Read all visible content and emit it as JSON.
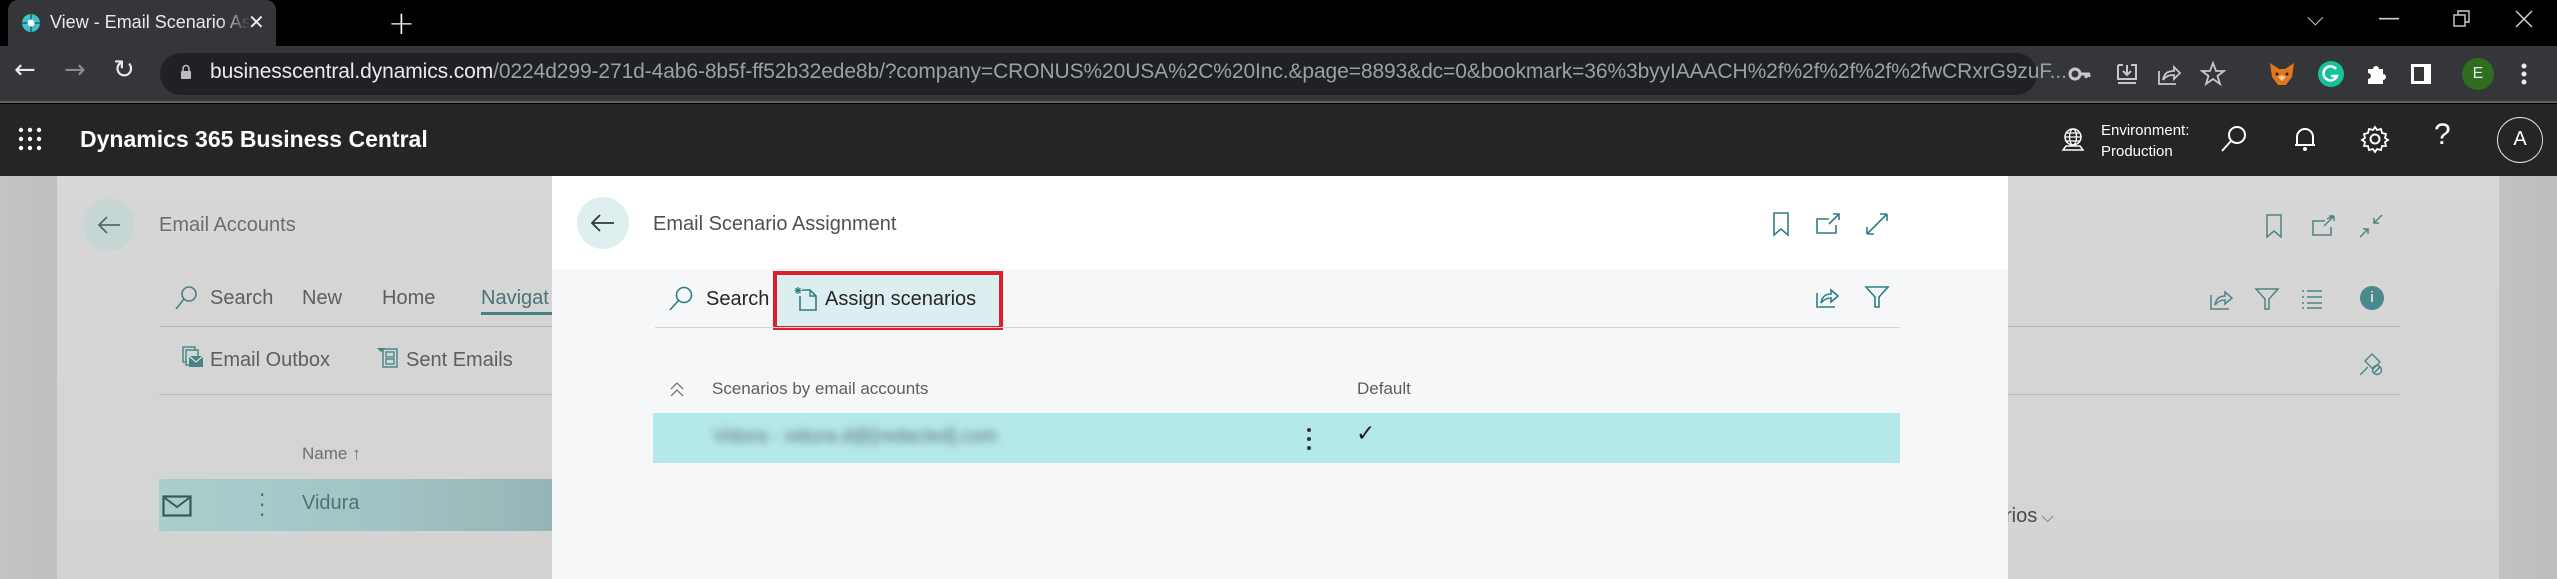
{
  "browser": {
    "tab_title": "View - Email Scenario Assignment",
    "tab_favicon": "dynamics-365-icon",
    "url_host": "businesscentral.dynamics.com",
    "url_path": "/0224d299-271d-4ab6-8b5f-ff52b32ede8b/?company=CRONUS%20USA%2C%20Inc.&page=8893&dc=0&bookmark=36%3byyIAAACH%2f%2f%2f%2f%2fwCRxrG9zuF...",
    "profile_initial": "E",
    "extensions": [
      "metamask-icon",
      "grammarly-icon",
      "extensions-puzzle-icon",
      "side-panel-icon"
    ],
    "address_icons": [
      "password-key-icon",
      "install-app-icon",
      "share-icon",
      "bookmark-star-icon"
    ]
  },
  "app": {
    "title": "Dynamics 365 Business Central",
    "environment_label": "Environment:",
    "environment_value": "Production",
    "avatar_initial": "A"
  },
  "background_page": {
    "title": "Email Accounts",
    "actions": [
      "Search",
      "New",
      "Home",
      "Navigat"
    ],
    "active_action": "Navigat",
    "sub_actions": [
      "Email Outbox",
      "Sent Emails"
    ],
    "column_header": "Name ↑",
    "row_name": "Vidura",
    "partial_text": "rios"
  },
  "modal": {
    "title": "Email Scenario Assignment",
    "actions": {
      "search": "Search",
      "assign": "Assign scenarios"
    },
    "highlight_color": "#dc1e2d",
    "columns": [
      "Scenarios by email accounts",
      "Default"
    ],
    "rows": [
      {
        "account": "Vidura - vidura.d@[redacted].com",
        "blurred": true,
        "default": "✓"
      }
    ]
  },
  "colors": {
    "accent": "#4a8184",
    "selected_row": "#b5e8eb",
    "header_bg": "#252525"
  }
}
